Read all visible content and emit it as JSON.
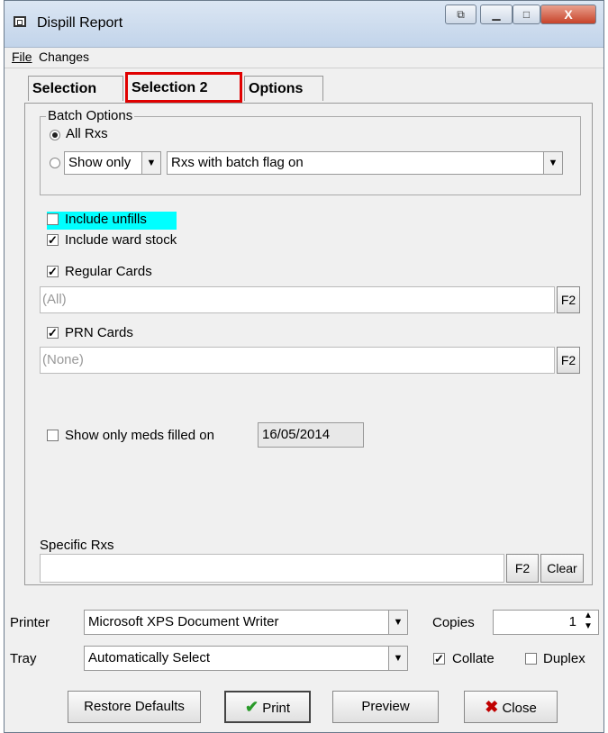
{
  "window": {
    "title": "Dispill Report"
  },
  "titlebar_buttons": {
    "close": "X"
  },
  "menu": {
    "file": "File",
    "changes": "Changes"
  },
  "tabs": [
    {
      "label": "Selection",
      "selected": false
    },
    {
      "label": "Selection 2",
      "selected": true
    },
    {
      "label": "Options",
      "selected": false
    }
  ],
  "batch": {
    "group_label": "Batch Options",
    "all_rxs_label": "All Rxs",
    "show_only_value": "Show only",
    "flag_value": "Rxs with batch flag on"
  },
  "include_unfills": {
    "label": "Include unfills",
    "checked": false
  },
  "include_ward_stock": {
    "label": "Include ward stock",
    "checked": true
  },
  "regular_cards": {
    "label": "Regular Cards",
    "checked": true,
    "value": "(All)",
    "f2": "F2"
  },
  "prn_cards": {
    "label": "PRN Cards",
    "checked": true,
    "value": "(None)",
    "f2": "F2"
  },
  "show_only_meds": {
    "label": "Show only meds filled on",
    "checked": false,
    "date": "16/05/2014"
  },
  "specific_rxs": {
    "label": "Specific Rxs",
    "value": "",
    "f2": "F2",
    "clear": "Clear"
  },
  "printer": {
    "label": "Printer",
    "value": "Microsoft XPS Document Writer"
  },
  "copies": {
    "label": "Copies",
    "value": "1"
  },
  "tray": {
    "label": "Tray",
    "value": "Automatically Select"
  },
  "collate": {
    "label": "Collate",
    "checked": true
  },
  "duplex": {
    "label": "Duplex",
    "checked": false
  },
  "buttons": {
    "restore": "Restore Defaults",
    "print": "Print",
    "preview": "Preview",
    "close": "Close"
  },
  "colors": {
    "highlight": "#00ffff",
    "tab_outline": "#e00000",
    "check_mark": "#2a9a2a",
    "close_x": "#c00000"
  }
}
